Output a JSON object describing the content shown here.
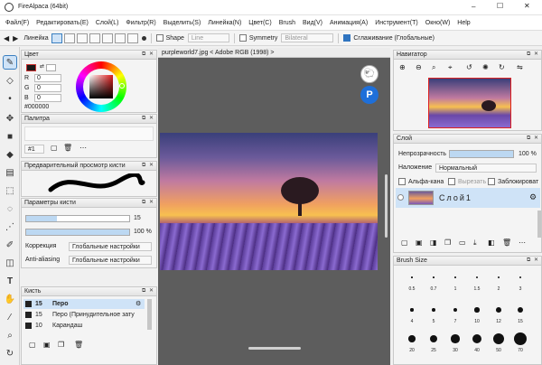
{
  "window": {
    "title": "FireAlpaca (64bit)",
    "controls": [
      "–",
      "☐",
      "✕"
    ]
  },
  "menu": [
    "Файл(F)",
    "Редактировать(E)",
    "Слой(L)",
    "Фильтр(R)",
    "Выделить(S)",
    "Линейка(N)",
    "Цвет(C)",
    "Brush",
    "Вид(V)",
    "Анимация(A)",
    "Инструмент(T)",
    "Окно(W)",
    "Help"
  ],
  "toolbar": {
    "ruler_label": "Линейка",
    "shape_label": "Shape",
    "shape_value": "Line",
    "symmetry_label": "Symmetry",
    "symmetry_value": "Bilateral",
    "smoothing_label": "Сглаживание (Глобальные)"
  },
  "color_panel": {
    "title": "Цвет",
    "r_label": "R",
    "r_value": "0",
    "g_label": "G",
    "g_value": "0",
    "b_label": "B",
    "b_value": "0",
    "hex": "#000000",
    "fg": "#1a1a1a",
    "bg": "#ffffff"
  },
  "palette_panel": {
    "title": "Палитра",
    "set": "#1"
  },
  "brush_preview_panel": {
    "title": "Предварительный просмотр кисти"
  },
  "brush_params_panel": {
    "title": "Параметры кисти",
    "size_value": "15",
    "opacity_value": "100 %",
    "correction_label": "Коррекция",
    "correction_value": "Глобальные настройки",
    "antialias_label": "Anti-aliasing",
    "antialias_value": "Глобальные настройки"
  },
  "brush_panel": {
    "title": "Кисть",
    "items": [
      {
        "size": "15",
        "name": "Перо"
      },
      {
        "size": "15",
        "name": "Перо (Принудительное зату"
      },
      {
        "size": "10",
        "name": "Карандаш"
      }
    ]
  },
  "document": {
    "tab": "purpleworld7.jpg < Adobe RGB (1998) >"
  },
  "navigator_panel": {
    "title": "Навигатор"
  },
  "layer_panel": {
    "title": "Слой",
    "opacity_label": "Непрозрачность",
    "opacity_value": "100 %",
    "blend_label": "Наложение",
    "blend_value": "Нормальный",
    "alpha_label": "Альфа-кана",
    "clip_label": "Вырезать",
    "lock_label": "Заблокироват",
    "layer_name": "Слой1"
  },
  "brush_size_panel": {
    "title": "Brush Size",
    "rows": [
      [
        "0.5",
        "0.7",
        "1",
        "1.5",
        "2",
        "3"
      ],
      [
        "4",
        "5",
        "7",
        "10",
        "12",
        "15"
      ],
      [
        "20",
        "25",
        "30",
        "40",
        "50",
        "70"
      ]
    ]
  }
}
